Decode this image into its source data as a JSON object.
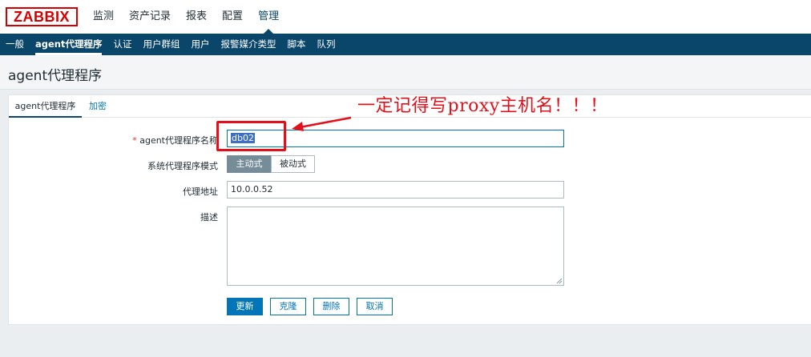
{
  "logo": "ZABBIX",
  "main_menu": [
    {
      "label": "监测"
    },
    {
      "label": "资产记录"
    },
    {
      "label": "报表"
    },
    {
      "label": "配置"
    },
    {
      "label": "管理",
      "active": true
    }
  ],
  "sub_menu": [
    {
      "label": "一般"
    },
    {
      "label": "agent代理程序",
      "active": true
    },
    {
      "label": "认证"
    },
    {
      "label": "用户群组"
    },
    {
      "label": "用户"
    },
    {
      "label": "报警媒介类型"
    },
    {
      "label": "脚本"
    },
    {
      "label": "队列"
    }
  ],
  "page_title": "agent代理程序",
  "tabs": {
    "proxy": "agent代理程序",
    "encryption": "加密"
  },
  "form": {
    "name_required_mark": "*",
    "name_label": "agent代理程序名称",
    "name_value": "db02",
    "mode_label": "系统代理程序模式",
    "mode_active": "主动式",
    "mode_passive": "被动式",
    "address_label": "代理地址",
    "address_value": "10.0.0.52",
    "description_label": "描述",
    "description_value": ""
  },
  "buttons": {
    "update": "更新",
    "clone": "克隆",
    "delete": "删除",
    "cancel": "取消"
  },
  "annotation": {
    "text": "一定记得写proxy主机名！！！",
    "color": "#e3101a"
  },
  "colors": {
    "brand": "#d40000",
    "nav": "#0a466a",
    "primary": "#0275b8"
  }
}
